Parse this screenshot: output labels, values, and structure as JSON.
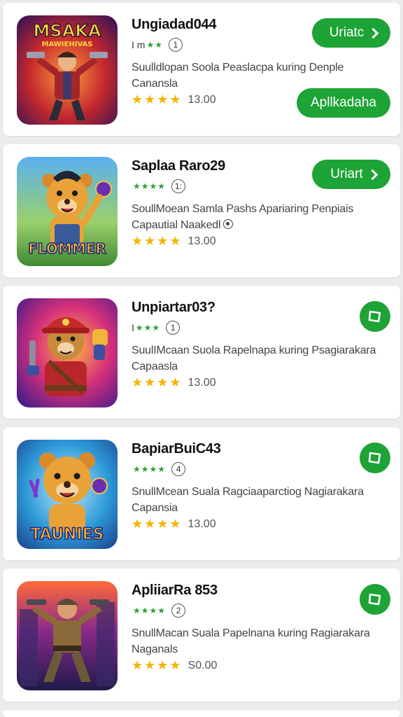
{
  "apps": [
    {
      "name": "Ungiadad044",
      "meta_prefix": "I m",
      "meta_stars": "★★",
      "meta_badge": "1",
      "desc_line1": "Suulldlopan Soola Peaslacpa kuring Denple",
      "desc_line2": "Canansla",
      "stars": "★★★★",
      "rating": "13.00",
      "update_label": "Uriatc",
      "apply_label": "Apllkadaha",
      "art": "hero-gunslinger",
      "art_title": "MSAKA",
      "art_subtitle": "MAWIEHIVAS"
    },
    {
      "name": "Saplaa Raro29",
      "meta_prefix": "",
      "meta_stars": "★★★★",
      "meta_badge": "1:",
      "desc_line1": "SoullMoean Samla Pashs Apariaring Penpiais",
      "desc_line2": "Capautial Naakedl",
      "stars": "★★★★",
      "rating": "13.00",
      "update_label": "Uriart",
      "art": "bear-flommer",
      "art_title": "FLOMMER"
    },
    {
      "name": "Unpiartar03?",
      "meta_prefix": "I",
      "meta_stars": "★★★",
      "meta_badge": "1",
      "desc_line1": "SuulIMcaan Suola Rapelnapa kuring Psagiarakara",
      "desc_line2": "Capaasla",
      "stars": "★★★★",
      "rating": "13.00",
      "art": "bear-gunner"
    },
    {
      "name": "BapiarBuiC43",
      "meta_prefix": "",
      "meta_stars": "★★★★",
      "meta_badge": "4",
      "desc_line1": "SnullMcean Suala Ragciaaparctiog Nagiarakara",
      "desc_line2": "Capansia",
      "stars": "★★★★",
      "rating": "13.00",
      "art": "bear-taunies",
      "art_title": "TAUNIES"
    },
    {
      "name": "ApliiarRa 853",
      "meta_prefix": "",
      "meta_stars": "★★★★",
      "meta_badge": "2",
      "desc_line1": "SnullMacan Suala Papelnana kuring Ragiarakara",
      "desc_line2": "Naganals",
      "stars": "★★★★",
      "rating": "S0.00",
      "art": "soldier"
    }
  ],
  "colors": {
    "accent_green": "#1ea336",
    "star_yellow": "#f4b400",
    "mini_star_green": "#2e9e3a",
    "background": "#ececec"
  },
  "icons": {
    "update_button": "chevron-right-icon",
    "action_button": "app-action-icon",
    "meta_badge": "age-rating-icon"
  }
}
